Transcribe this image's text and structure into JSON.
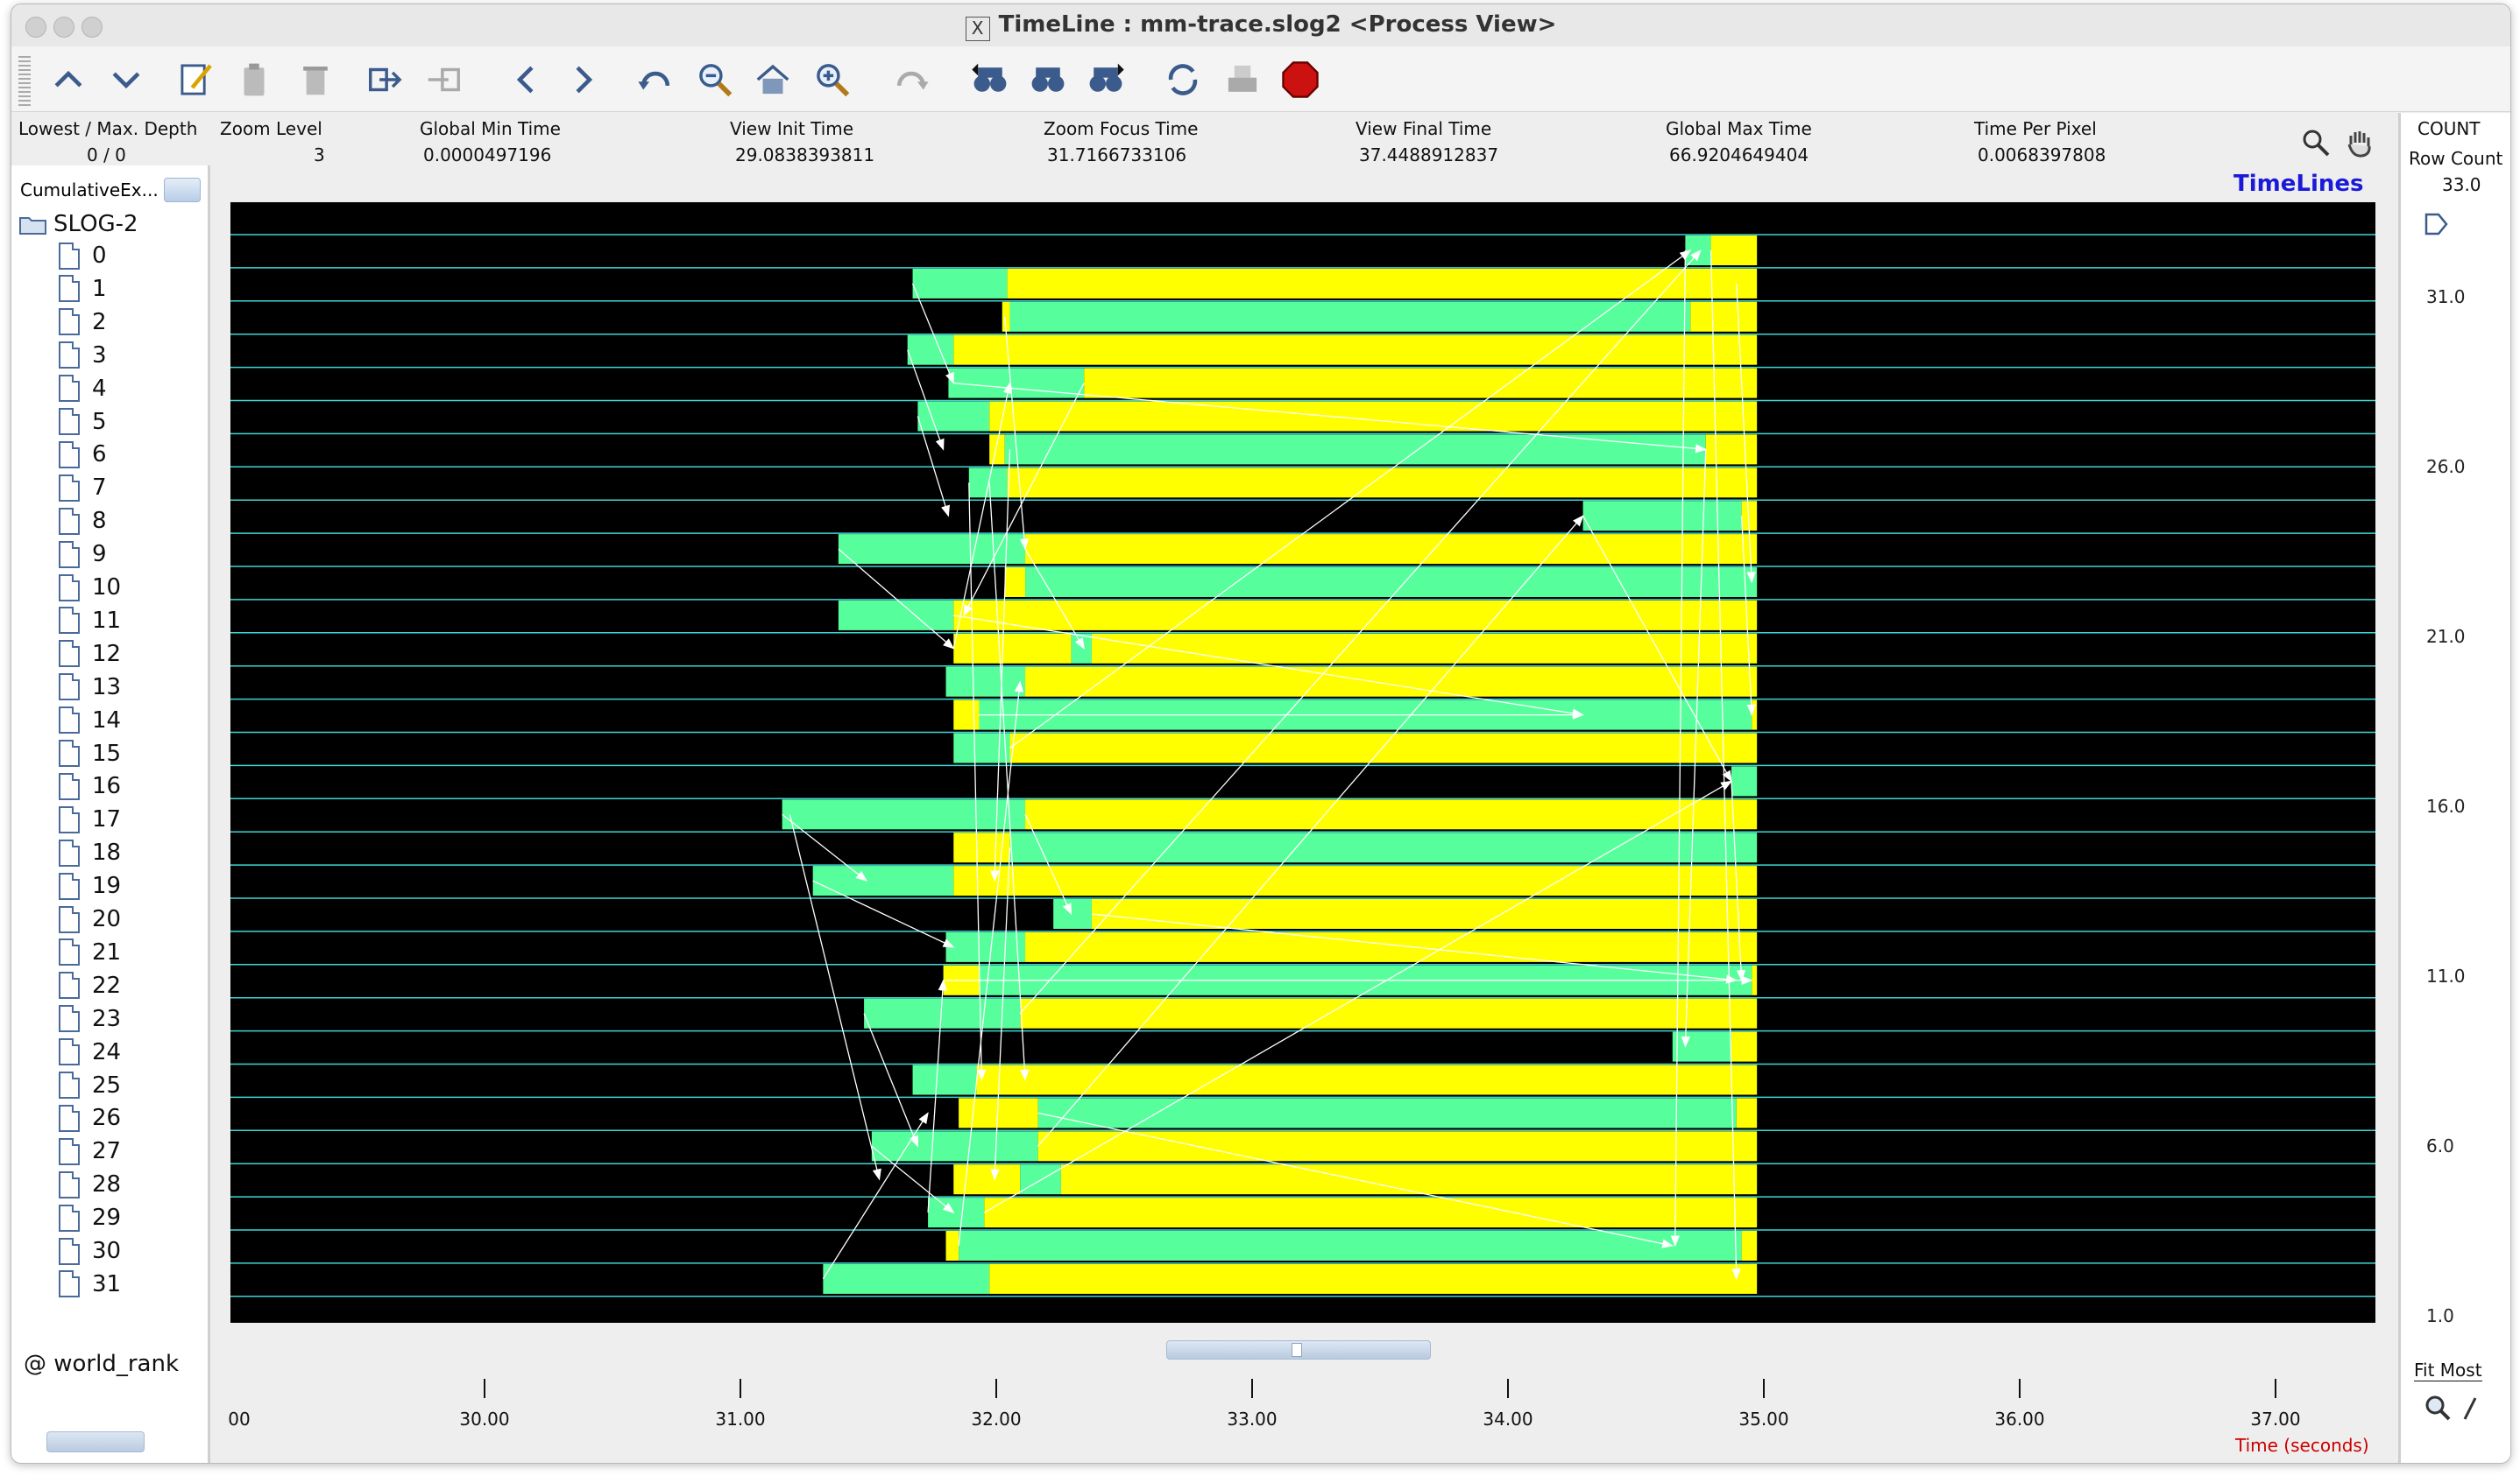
{
  "window": {
    "title": "TimeLine : mm-trace.slog2  <Process View>"
  },
  "toolbar": {
    "icons": [
      "up-icon",
      "down-icon",
      "edit-icon",
      "clipboard-icon",
      "trash-icon",
      "export-icon",
      "import-icon",
      "back-icon",
      "forward-icon",
      "undo-icon",
      "zoom-out-icon",
      "home-icon",
      "zoom-in-icon",
      "redo-icon",
      "search-backward-icon",
      "search-icon",
      "search-forward-icon",
      "refresh-icon",
      "print-icon",
      "stop-icon"
    ]
  },
  "info": {
    "depth_label": "Lowest / Max. Depth",
    "depth_value": "0 / 0",
    "zoom_label": "Zoom Level",
    "zoom_value": "3",
    "gmin_label": "Global Min Time",
    "gmin_value": "0.0000497196",
    "vinit_label": "View  Init Time",
    "vinit_value": "29.0838393811",
    "focus_label": "Zoom Focus Time",
    "focus_value": "31.7166733106",
    "vfinal_label": "View Final Time",
    "vfinal_value": "37.4488912837",
    "gmax_label": "Global Max Time",
    "gmax_value": "66.9204649404",
    "tpp_label": "Time Per Pixel",
    "tpp_value": "0.0068397808",
    "timelines_label": "TimeLines"
  },
  "left": {
    "combo_value": "CumulativeEx...",
    "root": "SLOG-2",
    "ranks": [
      "0",
      "1",
      "2",
      "3",
      "4",
      "5",
      "6",
      "7",
      "8",
      "9",
      "10",
      "11",
      "12",
      "13",
      "14",
      "15",
      "16",
      "17",
      "18",
      "19",
      "20",
      "21",
      "22",
      "23",
      "24",
      "25",
      "26",
      "27",
      "28",
      "29",
      "30",
      "31"
    ],
    "footer": "@ world_rank"
  },
  "right": {
    "count_label": "COUNT",
    "rowcount_label": "Row Count",
    "rowcount_value": "33.0",
    "ticks": [
      "31.0",
      "26.0",
      "21.0",
      "16.0",
      "11.0",
      "6.0",
      "1.0"
    ],
    "fit_label": "Fit Most"
  },
  "axis": {
    "labels": [
      "00",
      "30.00",
      "31.00",
      "32.00",
      "33.00",
      "34.00",
      "35.00",
      "36.00",
      "37.00"
    ],
    "unit_label": "Time (seconds)"
  },
  "timeline": {
    "view_start": 29.0838,
    "view_end": 37.4489,
    "colors": {
      "background": "#000000",
      "grid": "#3fd6d6",
      "state_a": "#56ff9c",
      "state_b": "#ffff00",
      "arrow": "#ffffff",
      "unit_label": "#cc0000",
      "timelines_label": "#1a1ad8"
    },
    "rows": [
      {
        "rank": 0,
        "segs": [
          [
            "a",
            34.7,
            34.8
          ],
          [
            "b",
            34.8,
            34.98
          ]
        ]
      },
      {
        "rank": 1,
        "segs": [
          [
            "a",
            31.68,
            32.05
          ],
          [
            "b",
            32.05,
            34.98
          ]
        ]
      },
      {
        "rank": 2,
        "segs": [
          [
            "b",
            32.03,
            32.06
          ],
          [
            "a",
            32.06,
            34.72
          ],
          [
            "b",
            34.72,
            34.98
          ]
        ]
      },
      {
        "rank": 3,
        "segs": [
          [
            "a",
            31.66,
            31.84
          ],
          [
            "b",
            31.84,
            34.98
          ]
        ]
      },
      {
        "rank": 4,
        "segs": [
          [
            "a",
            31.82,
            32.35
          ],
          [
            "b",
            32.35,
            34.98
          ]
        ]
      },
      {
        "rank": 5,
        "segs": [
          [
            "a",
            31.7,
            31.98
          ],
          [
            "b",
            31.98,
            34.98
          ]
        ]
      },
      {
        "rank": 6,
        "segs": [
          [
            "b",
            31.98,
            32.04
          ],
          [
            "a",
            32.04,
            34.78
          ],
          [
            "b",
            34.78,
            34.98
          ]
        ]
      },
      {
        "rank": 7,
        "segs": [
          [
            "a",
            31.9,
            32.05
          ],
          [
            "b",
            32.05,
            34.98
          ]
        ]
      },
      {
        "rank": 8,
        "segs": [
          [
            "a",
            34.3,
            34.92
          ],
          [
            "b",
            34.92,
            34.98
          ]
        ]
      },
      {
        "rank": 9,
        "segs": [
          [
            "a",
            31.39,
            32.12
          ],
          [
            "b",
            32.12,
            34.98
          ]
        ]
      },
      {
        "rank": 10,
        "segs": [
          [
            "b",
            32.04,
            32.12
          ],
          [
            "a",
            32.12,
            34.98
          ]
        ]
      },
      {
        "rank": 11,
        "segs": [
          [
            "a",
            31.39,
            31.84
          ],
          [
            "b",
            31.84,
            34.98
          ]
        ]
      },
      {
        "rank": 12,
        "segs": [
          [
            "b",
            31.84,
            32.3
          ],
          [
            "a",
            32.3,
            32.38
          ],
          [
            "b",
            32.38,
            34.98
          ]
        ]
      },
      {
        "rank": 13,
        "segs": [
          [
            "a",
            31.81,
            32.12
          ],
          [
            "b",
            32.12,
            34.98
          ]
        ]
      },
      {
        "rank": 14,
        "segs": [
          [
            "b",
            31.84,
            31.94
          ],
          [
            "a",
            31.94,
            34.96
          ],
          [
            "b",
            34.96,
            34.98
          ]
        ]
      },
      {
        "rank": 15,
        "segs": [
          [
            "a",
            31.84,
            32.06
          ],
          [
            "b",
            32.06,
            34.98
          ]
        ]
      },
      {
        "rank": 16,
        "segs": [
          [
            "a",
            34.88,
            34.98
          ]
        ]
      },
      {
        "rank": 17,
        "segs": [
          [
            "a",
            31.17,
            32.12
          ],
          [
            "b",
            32.12,
            34.98
          ]
        ]
      },
      {
        "rank": 18,
        "segs": [
          [
            "b",
            31.84,
            32.06
          ],
          [
            "a",
            32.06,
            34.98
          ]
        ]
      },
      {
        "rank": 19,
        "segs": [
          [
            "a",
            31.29,
            31.84
          ],
          [
            "b",
            31.84,
            34.98
          ]
        ]
      },
      {
        "rank": 20,
        "segs": [
          [
            "a",
            32.23,
            32.38
          ],
          [
            "b",
            32.38,
            34.98
          ]
        ]
      },
      {
        "rank": 21,
        "segs": [
          [
            "a",
            31.81,
            32.12
          ],
          [
            "b",
            32.12,
            34.98
          ]
        ]
      },
      {
        "rank": 22,
        "segs": [
          [
            "b",
            31.8,
            31.94
          ],
          [
            "a",
            31.94,
            34.96
          ],
          [
            "b",
            34.96,
            34.98
          ]
        ]
      },
      {
        "rank": 23,
        "segs": [
          [
            "a",
            31.49,
            32.1
          ],
          [
            "b",
            32.1,
            34.98
          ]
        ]
      },
      {
        "rank": 24,
        "segs": [
          [
            "a",
            34.65,
            34.88
          ],
          [
            "b",
            34.88,
            34.98
          ]
        ]
      },
      {
        "rank": 25,
        "segs": [
          [
            "a",
            31.68,
            31.93
          ],
          [
            "b",
            31.93,
            34.98
          ]
        ]
      },
      {
        "rank": 26,
        "segs": [
          [
            "b",
            31.86,
            32.17
          ],
          [
            "a",
            32.17,
            34.9
          ],
          [
            "b",
            34.9,
            34.98
          ]
        ]
      },
      {
        "rank": 27,
        "segs": [
          [
            "a",
            31.52,
            32.17
          ],
          [
            "b",
            32.17,
            34.98
          ]
        ]
      },
      {
        "rank": 28,
        "segs": [
          [
            "b",
            31.84,
            32.1
          ],
          [
            "a",
            32.1,
            32.26
          ],
          [
            "b",
            32.26,
            34.98
          ]
        ]
      },
      {
        "rank": 29,
        "segs": [
          [
            "a",
            31.74,
            31.96
          ],
          [
            "b",
            31.96,
            34.98
          ]
        ]
      },
      {
        "rank": 30,
        "segs": [
          [
            "b",
            31.81,
            31.86
          ],
          [
            "a",
            31.86,
            34.92
          ],
          [
            "b",
            34.92,
            34.98
          ]
        ]
      },
      {
        "rank": 31,
        "segs": [
          [
            "a",
            31.33,
            31.98
          ],
          [
            "b",
            31.98,
            34.98
          ]
        ]
      }
    ],
    "arrows": [
      [
        31.2,
        17,
        31.55,
        28
      ],
      [
        31.39,
        9,
        31.84,
        12
      ],
      [
        31.17,
        17,
        31.5,
        19
      ],
      [
        31.29,
        19,
        31.84,
        21
      ],
      [
        31.49,
        23,
        31.7,
        27
      ],
      [
        31.33,
        31,
        31.74,
        26
      ],
      [
        31.52,
        27,
        31.84,
        29
      ],
      [
        31.68,
        1,
        31.84,
        4
      ],
      [
        31.66,
        3,
        31.8,
        6
      ],
      [
        31.7,
        5,
        31.82,
        8
      ],
      [
        31.74,
        29,
        31.8,
        22
      ],
      [
        31.86,
        30,
        32.1,
        13
      ],
      [
        32.04,
        2,
        32.12,
        9
      ],
      [
        32.06,
        6,
        32.0,
        19
      ],
      [
        31.84,
        12,
        32.06,
        4
      ],
      [
        31.98,
        7,
        32.12,
        25
      ],
      [
        32.12,
        9,
        32.35,
        12
      ],
      [
        32.12,
        17,
        32.3,
        20
      ],
      [
        31.84,
        11,
        34.3,
        14
      ],
      [
        32.38,
        20,
        34.9,
        22
      ],
      [
        32.06,
        15,
        34.72,
        0
      ],
      [
        32.17,
        27,
        34.3,
        8
      ],
      [
        31.96,
        29,
        34.88,
        16
      ],
      [
        32.1,
        23,
        34.76,
        0
      ],
      [
        34.7,
        0,
        34.66,
        30
      ],
      [
        34.8,
        0,
        34.9,
        31
      ],
      [
        34.78,
        6,
        34.7,
        24
      ],
      [
        34.92,
        8,
        34.96,
        14
      ],
      [
        34.3,
        8,
        34.88,
        16
      ],
      [
        34.88,
        16,
        34.92,
        22
      ],
      [
        31.84,
        4,
        34.78,
        6
      ],
      [
        32.35,
        4,
        31.88,
        11
      ],
      [
        31.94,
        14,
        34.3,
        14
      ],
      [
        31.8,
        22,
        34.96,
        22
      ],
      [
        32.17,
        26,
        34.65,
        30
      ],
      [
        34.9,
        1,
        34.96,
        10
      ],
      [
        32.06,
        18,
        32.0,
        28
      ],
      [
        31.9,
        7,
        31.95,
        25
      ]
    ]
  }
}
